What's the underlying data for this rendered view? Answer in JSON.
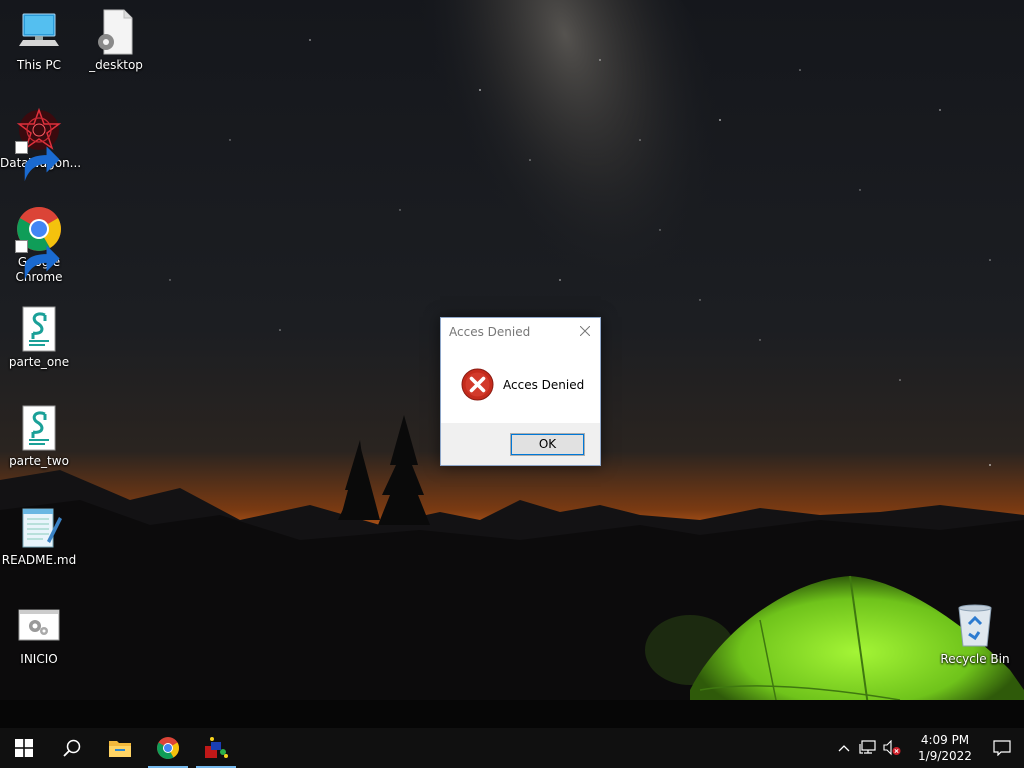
{
  "desktop": {
    "icons": [
      {
        "label": "This PC",
        "icon": "this-pc-icon"
      },
      {
        "label": "_desktop",
        "icon": "settings-file-icon"
      },
      {
        "label": "DataWagon...",
        "icon": "datawagon-icon"
      },
      {
        "label": "Google Chrome",
        "icon": "chrome-icon"
      },
      {
        "label": "parte_one",
        "icon": "script-file-icon"
      },
      {
        "label": "parte_two",
        "icon": "script-file-icon"
      },
      {
        "label": "README.md",
        "icon": "notepad-icon"
      },
      {
        "label": "INICIO",
        "icon": "settings-window-icon"
      },
      {
        "label": "Recycle Bin",
        "icon": "recycle-bin-icon"
      }
    ]
  },
  "dialog": {
    "title": "Acces Denied",
    "message": "Acces Denied",
    "ok_label": "OK",
    "icon": "error-icon"
  },
  "taskbar": {
    "buttons": [
      "windows-start-icon",
      "search-icon",
      "file-explorer-icon",
      "chrome-icon",
      "app-icon"
    ],
    "clock": {
      "time": "4:09 PM",
      "date": "1/9/2022"
    }
  },
  "colors": {
    "taskbar": "#101010",
    "accent": "#0078d7",
    "error_red": "#c42b1c",
    "tent_green": "#8ee02a"
  }
}
